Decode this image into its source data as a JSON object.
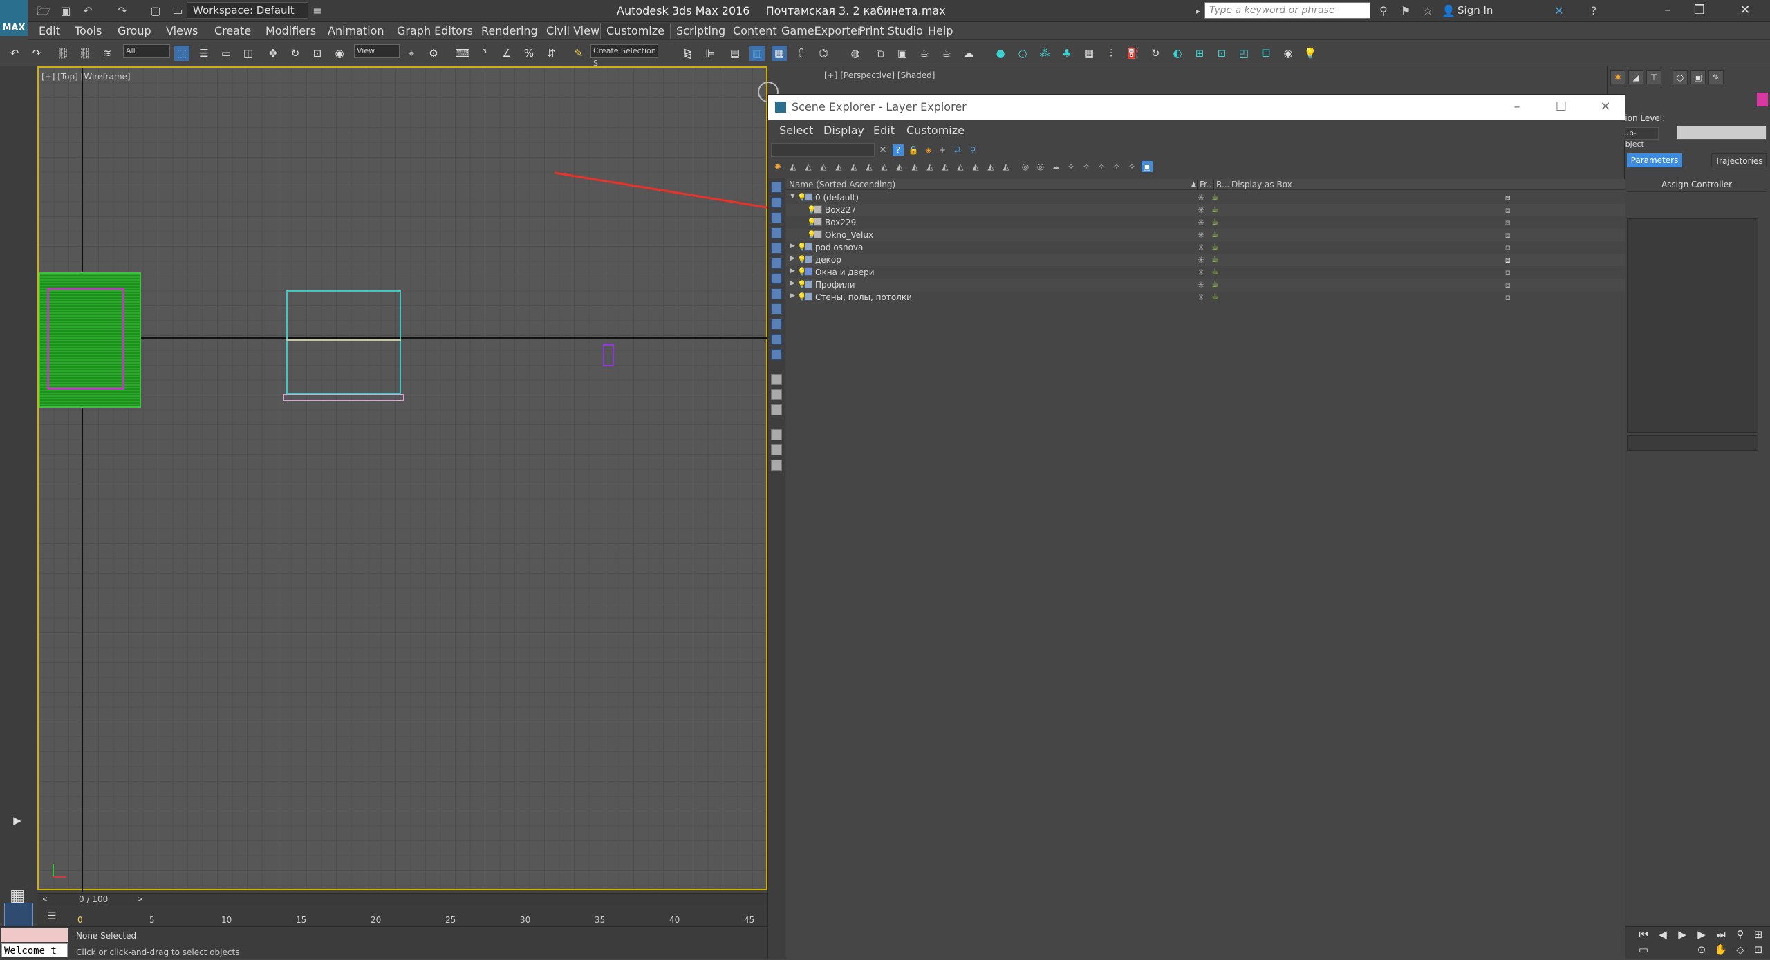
{
  "app": {
    "title": "Autodesk 3ds Max 2016",
    "file_name": "Почтамская 3. 2 кабинета.max",
    "logo_text": "MAX",
    "workspace": "Workspace: Default",
    "search_placeholder": "Type a keyword or phrase",
    "sign_in": "Sign In"
  },
  "menu": [
    "Edit",
    "Tools",
    "Group",
    "Views",
    "Create",
    "Modifiers",
    "Animation",
    "Graph Editors",
    "Rendering",
    "Civil View",
    "Customize",
    "Scripting",
    "Content",
    "GameExporter",
    "Print Studio",
    "Help"
  ],
  "active_menu": "Customize",
  "toolbar": {
    "filter_value": "All",
    "ref_coord_value": "View",
    "selection_set_value": "Create Selection S"
  },
  "viewports": {
    "top_label": "[+] [Top] [Wireframe]",
    "persp_label": "[+] [Perspective] [Shaded]"
  },
  "timeline": {
    "slider_label": "0 / 100",
    "ticks": [
      "0",
      "5",
      "10",
      "15",
      "20",
      "25",
      "30",
      "35",
      "40",
      "45"
    ]
  },
  "status": {
    "console": "Welcome t",
    "line1": "None Selected",
    "line2": "Click or click-and-drag to select objects"
  },
  "explorer": {
    "title": "Scene Explorer - Layer Explorer",
    "menu": [
      "Select",
      "Display",
      "Edit",
      "Customize"
    ],
    "columns": {
      "name": "Name (Sorted Ascending)",
      "frozen": "Fr...",
      "render": "R...",
      "display_box": "Display as Box"
    },
    "rows": [
      {
        "name": "0 (default)",
        "type": "layer",
        "depth": 0,
        "expanded": true
      },
      {
        "name": "Box227",
        "type": "object",
        "depth": 1
      },
      {
        "name": "Box229",
        "type": "object",
        "depth": 1
      },
      {
        "name": "Okno_Velux",
        "type": "object",
        "depth": 1
      },
      {
        "name": "pod osnova",
        "type": "layer",
        "depth": 0
      },
      {
        "name": "декор",
        "type": "layer",
        "depth": 0
      },
      {
        "name": "Окна и двери",
        "type": "layer",
        "depth": 0
      },
      {
        "name": "Профили",
        "type": "layer",
        "depth": 0
      },
      {
        "name": "Стены, полы, потолки",
        "type": "layer",
        "depth": 0
      }
    ]
  },
  "command_panel": {
    "selection_level": "ction Level:",
    "sub_object": "Sub-Object",
    "tab_parameters": "Parameters",
    "tab_trajectories": "Trajectories",
    "assign_controller": "Assign Controller",
    "color_swatch": "#d63aa0"
  },
  "colors": {
    "accent_blue": "#3e8ce0",
    "viewport_border": "#d0b000",
    "annotation_arrow": "#e8322a"
  }
}
